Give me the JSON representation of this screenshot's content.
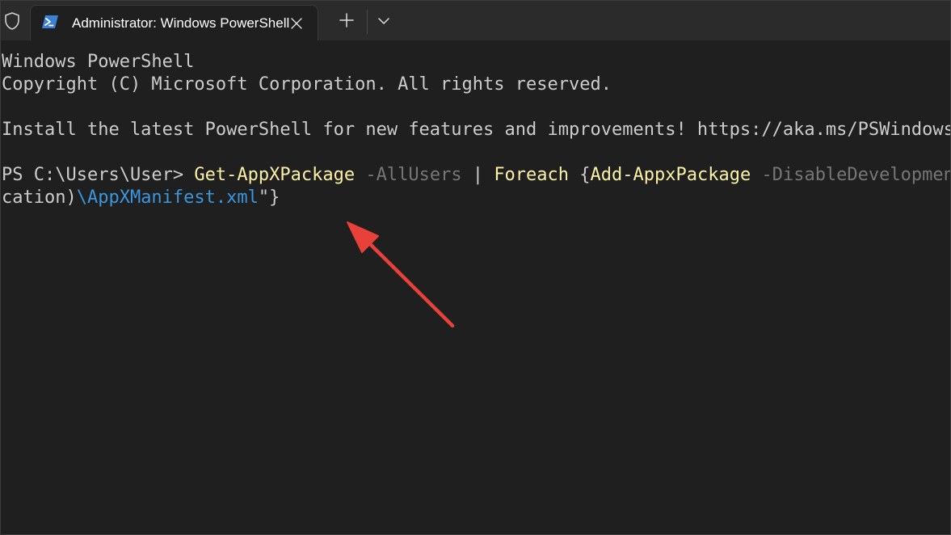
{
  "window": {
    "tab_title": "Administrator: Windows PowerShell",
    "icons": {
      "shield": "shield-icon",
      "powershell": "powershell-icon",
      "close": "close-icon",
      "new_tab": "plus-icon",
      "dropdown": "chevron-down-icon"
    }
  },
  "terminal": {
    "line1": "Windows PowerShell",
    "line2": "Copyright (C) Microsoft Corporation. All rights reserved.",
    "line3": "Install the latest PowerShell for new features and improvements! https://aka.ms/PSWindows",
    "prompt": "PS C:\\Users\\User> ",
    "command": {
      "cmdlet1": "Get-AppXPackage",
      "param1": " -AllUsers",
      "pipe": " | ",
      "foreach": "Foreach",
      "brace_open": " {",
      "cmdlet2": "Add-AppxPackage",
      "param2": " -DisableDevelopmentMode -Register \"$($_.InstallLocation)"
    },
    "continuation": {
      "text": "cation)",
      "path": "\\AppXManifest.xml",
      "close": "\"}"
    },
    "colors": {
      "background": "#1f1f1f",
      "foreground": "#cccccc",
      "cmdlet": "#f9f1a5",
      "parameter": "#767676",
      "string": "#3a96dd"
    }
  },
  "annotation": {
    "arrow_color": "#e8413a"
  }
}
